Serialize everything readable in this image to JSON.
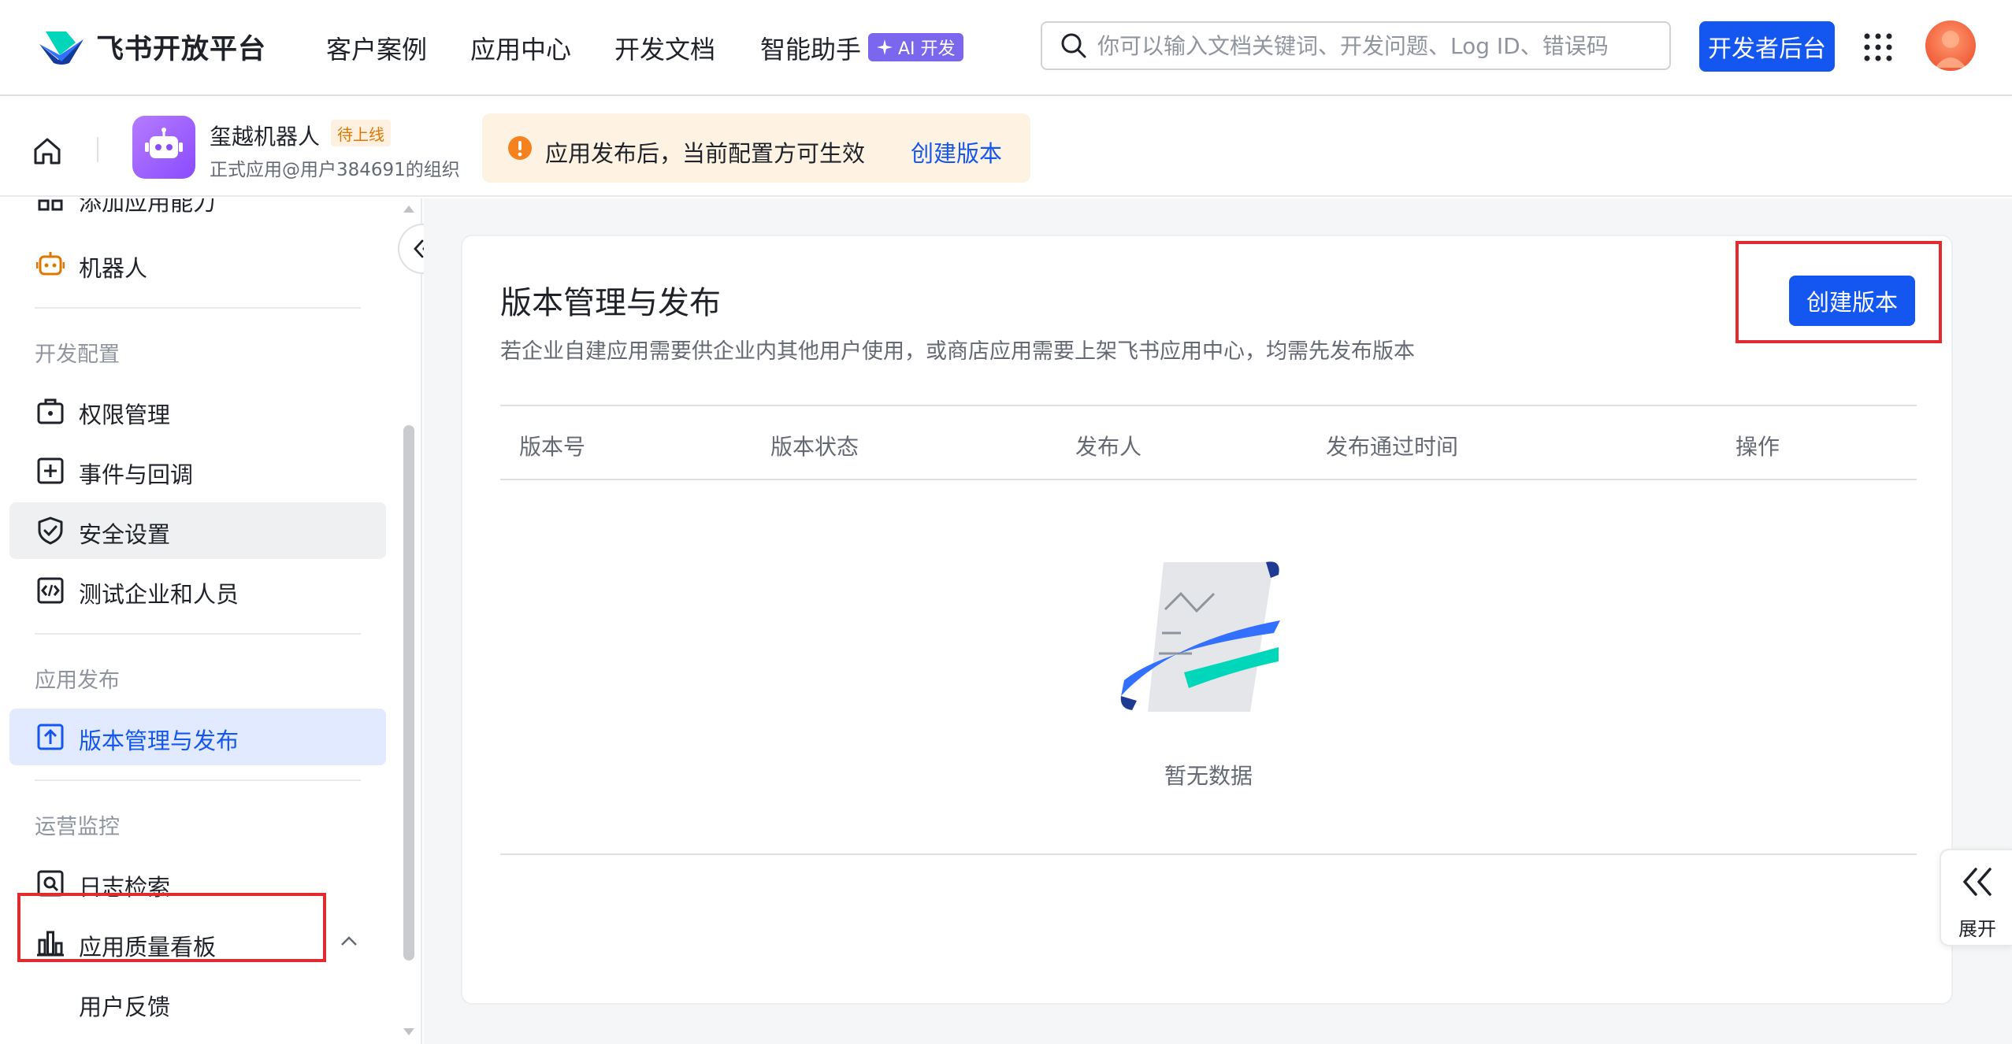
{
  "topnav": {
    "brand": "飞书开放平台",
    "items": [
      "客户案例",
      "应用中心",
      "开发文档",
      "智能助手"
    ],
    "ai_badge": "AI 开发",
    "search_placeholder": "你可以输入文档关键词、开发问题、Log ID、错误码",
    "dev_console": "开发者后台",
    "accent": "#1456f0"
  },
  "app": {
    "name": "玺越机器人",
    "status_tag": "待上线",
    "org": "正式应用@用户384691的组织"
  },
  "notice": {
    "text": "应用发布后，当前配置方可生效",
    "link": "创建版本"
  },
  "sidebar": {
    "items_top": [
      {
        "label": "添加应用能力",
        "icon": "add-capability-icon"
      },
      {
        "label": "机器人",
        "icon": "robot-icon"
      }
    ],
    "section_dev": "开发配置",
    "items_dev": [
      {
        "label": "权限管理",
        "icon": "permission-icon"
      },
      {
        "label": "事件与回调",
        "icon": "event-icon"
      },
      {
        "label": "安全设置",
        "icon": "shield-icon"
      },
      {
        "label": "测试企业和人员",
        "icon": "code-icon"
      }
    ],
    "section_publish": "应用发布",
    "items_publish": [
      {
        "label": "版本管理与发布",
        "icon": "upload-icon"
      }
    ],
    "section_ops": "运营监控",
    "items_ops": [
      {
        "label": "日志检索",
        "icon": "log-search-icon"
      },
      {
        "label": "应用质量看板",
        "icon": "chart-icon"
      },
      {
        "label": "用户反馈",
        "icon": ""
      }
    ]
  },
  "main": {
    "title": "版本管理与发布",
    "description": "若企业自建应用需要供企业内其他用户使用，或商店应用需要上架飞书应用中心，均需先发布版本",
    "create_button": "创建版本",
    "columns": [
      "版本号",
      "版本状态",
      "发布人",
      "发布通过时间",
      "操作"
    ],
    "empty_text": "暂无数据"
  },
  "expand_tab": {
    "label": "展开"
  },
  "colors": {
    "highlight": "#e22a2f",
    "active_bg": "#e1eaff",
    "notice_bg": "#fef3e3",
    "warning": "#f5821f"
  }
}
